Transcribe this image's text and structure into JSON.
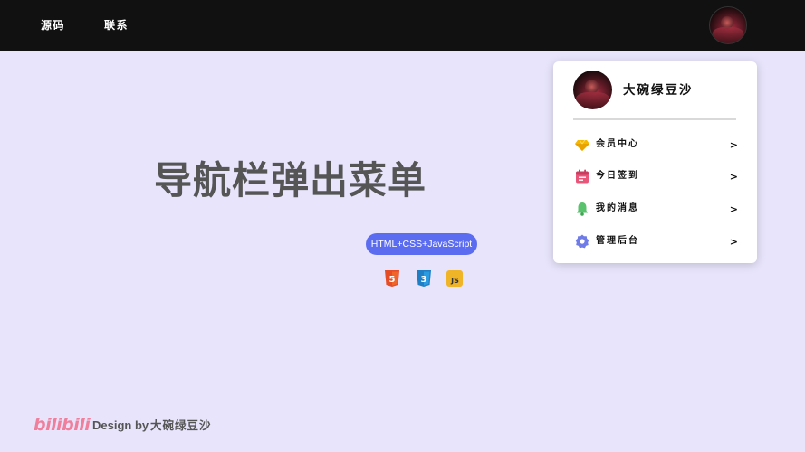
{
  "nav": {
    "links": [
      {
        "label": "源码"
      },
      {
        "label": "联系"
      }
    ]
  },
  "hero": {
    "title": "导航栏弹出菜单",
    "tech_pill": "HTML+CSS+JavaScript",
    "tech_icons": [
      {
        "name": "html5-icon",
        "label": "5",
        "color": "#e44d26"
      },
      {
        "name": "css3-icon",
        "label": "3",
        "color": "#2a9be0"
      },
      {
        "name": "js-icon",
        "label": "JS",
        "color": "#f0b428"
      }
    ]
  },
  "dropdown": {
    "username": "大碗绿豆沙",
    "items": [
      {
        "label": "会员中心",
        "icon": "gem-icon",
        "arrow": ">"
      },
      {
        "label": "今日签到",
        "icon": "calendar-icon",
        "arrow": ">"
      },
      {
        "label": "我的消息",
        "icon": "bell-icon",
        "arrow": ">"
      },
      {
        "label": "管理后台",
        "icon": "gear-icon",
        "arrow": ">"
      }
    ]
  },
  "footer": {
    "logo": "bilibili",
    "design_by": "Design by",
    "author": "大碗绿豆沙"
  },
  "colors": {
    "topbar": "#111111",
    "background": "#e7e4fb",
    "pill": "#5b6cf0",
    "bilibili_pink": "#f07f9c",
    "gem": "#f5b800",
    "calendar": "#e8567a",
    "bell": "#58c26c",
    "gear": "#6f7ce8"
  }
}
